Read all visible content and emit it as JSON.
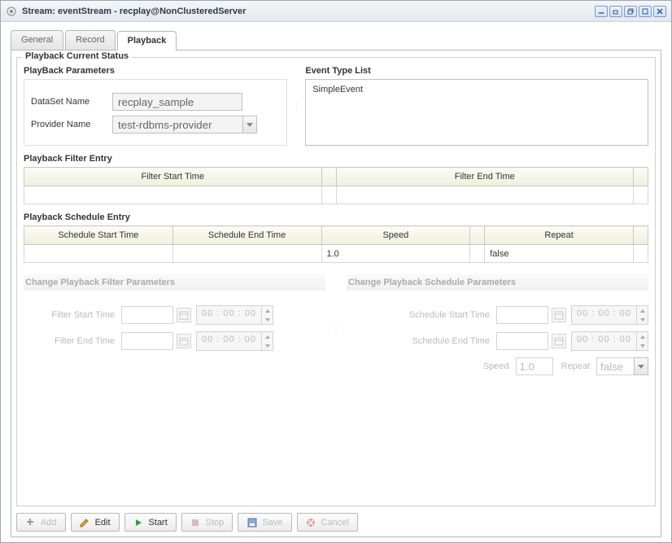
{
  "window": {
    "title": "Stream: eventStream - recplay@NonClusteredServer"
  },
  "tabs": {
    "general": "General",
    "record": "Record",
    "playback": "Playback"
  },
  "status": {
    "legend": "Playback Current Status",
    "params_legend": "PlayBack Parameters",
    "dataset_label": "DataSet Name",
    "dataset_value": "recplay_sample",
    "provider_label": "Provider Name",
    "provider_value": "test-rdbms-provider",
    "eventtype_legend": "Event Type List",
    "eventtype_item": "SimpleEvent"
  },
  "filter_entry": {
    "title": "Playback Filter Entry",
    "col_start": "Filter Start Time",
    "col_end": "Filter End Time"
  },
  "schedule_entry": {
    "title": "Playback Schedule Entry",
    "col_start": "Schedule Start Time",
    "col_end": "Schedule End Time",
    "col_speed": "Speed",
    "col_repeat": "Repeat",
    "row": {
      "start": "",
      "end": "",
      "speed": "1.0",
      "repeat": "false"
    }
  },
  "change_filter": {
    "title": "Change Playback Filter Parameters",
    "start_label": "Filter Start Time",
    "end_label": "Filter End Time",
    "time_text": "00 : 00 : 00"
  },
  "change_schedule": {
    "title": "Change Playback Schedule Parameters",
    "start_label": "Schedule Start Time",
    "end_label": "Schedule End Time",
    "time_text": "00 : 00 : 00",
    "speed_label": "Speed",
    "speed_value": "1.0",
    "repeat_label": "Repeat",
    "repeat_value": "false"
  },
  "toolbar": {
    "add": "Add",
    "edit": "Edit",
    "start": "Start",
    "stop": "Stop",
    "save": "Save",
    "cancel": "Cancel"
  }
}
